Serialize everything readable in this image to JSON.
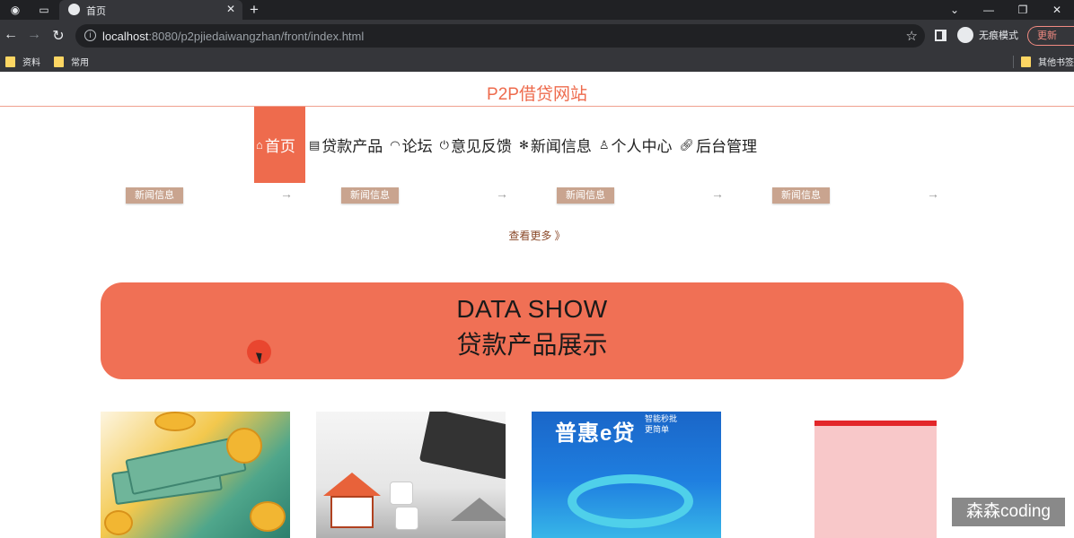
{
  "browser": {
    "tab_title": "首页",
    "url_host": "localhost",
    "url_rest": ":8080/p2pjiedaiwangzhan/front/index.html",
    "incognito_label": "无痕模式",
    "update_label": "更新",
    "bookmarks": [
      "资料",
      "常用"
    ],
    "other_bookmarks": "其他书签"
  },
  "site": {
    "title": "P2P借贷网站",
    "nav": [
      {
        "label": "首页",
        "icon": "home-icon"
      },
      {
        "label": "贷款产品",
        "icon": "card-icon"
      },
      {
        "label": "论坛",
        "icon": "gauge-icon"
      },
      {
        "label": "意见反馈",
        "icon": "power-icon"
      },
      {
        "label": "新闻信息",
        "icon": "snowflake-icon"
      },
      {
        "label": "个人中心",
        "icon": "user-icon"
      },
      {
        "label": "后台管理",
        "icon": "link-icon"
      }
    ],
    "news_badges": [
      "新闻信息",
      "新闻信息",
      "新闻信息",
      "新闻信息"
    ],
    "more_label": "查看更多 》",
    "data_show_en": "DATA SHOW",
    "data_show_zh": "贷款产品展示",
    "product3_title": "普惠e贷",
    "product3_sub": "智能秒批\n更简单"
  },
  "colors": {
    "accent": "#ee6b4d",
    "badge": "#c9a48f",
    "banner": "#f07055"
  },
  "watermark": "森森coding"
}
